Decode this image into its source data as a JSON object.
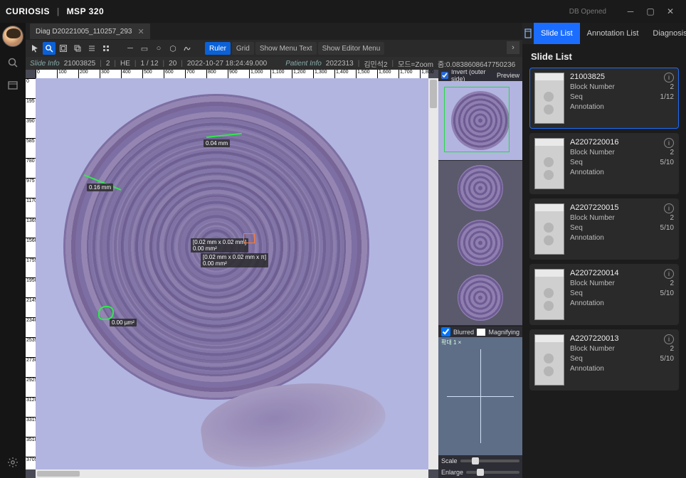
{
  "app": {
    "brand1": "CURIOSIS",
    "brand2": "MSP 320",
    "db_status": "DB Opened"
  },
  "tab": {
    "title": "Diag D20221005_110257_293"
  },
  "toolbar": {
    "ruler": "Ruler",
    "grid": "Grid",
    "menutext": "Show Menu Text",
    "editormenu": "Show Editor Menu"
  },
  "slideinfo": {
    "label": "Slide Info",
    "id": "21003825",
    "block": "2",
    "stain": "HE",
    "seq": "1 / 12",
    "mag": "20",
    "datetime": "2022-10-27 18:24:49.000",
    "patient_label": "Patient Info",
    "patient_id": "2022313",
    "patient_name": "김민석2",
    "mode_label": "모드=Zoom",
    "zoom": "줌:0.0838608647750236"
  },
  "ruler_h": [
    "0",
    "100",
    "200",
    "300",
    "400",
    "500",
    "600",
    "700",
    "800",
    "900",
    "1,000",
    "1,100",
    "1,200",
    "1,300",
    "1,400",
    "1,500",
    "1,600",
    "1,700",
    "1,800"
  ],
  "ruler_v": [
    "0",
    "195",
    "390",
    "585",
    "780",
    "975",
    "1170",
    "1365",
    "1560",
    "1755",
    "1950",
    "2145",
    "2340",
    "2535",
    "2730",
    "2925",
    "3120",
    "3315",
    "3510",
    "3705"
  ],
  "measurements": {
    "m1": "0.04 mm",
    "m2": "0.16 mm",
    "m3a": "[0.02 mm x 0.02 mm]",
    "m3b": "0.00 mm²",
    "m4a": "[0.02 mm x 0.02 mm x π]",
    "m4b": "0.00 mm²",
    "m5": "0.00 µm²"
  },
  "panels": {
    "invert": "Invert (outer side)",
    "preview": "Preview",
    "blurred": "Blurred",
    "magnify": "Magnifying",
    "navlabel": "확대 1 ×",
    "scale": "Scale",
    "enlarge": "Enlarge"
  },
  "right": {
    "tabs": {
      "slidelist": "Slide List",
      "annotation": "Annotation List",
      "diagnosis": "Diagnosis"
    },
    "title": "Slide List",
    "fields": {
      "block": "Block Number",
      "seq": "Seq",
      "anno": "Annotation"
    },
    "cards": [
      {
        "name": "21003825",
        "block": "2",
        "seq": "1/12",
        "active": true
      },
      {
        "name": "A2207220016",
        "block": "2",
        "seq": "5/10",
        "active": false
      },
      {
        "name": "A2207220015",
        "block": "2",
        "seq": "5/10",
        "active": false
      },
      {
        "name": "A2207220014",
        "block": "2",
        "seq": "5/10",
        "active": false
      },
      {
        "name": "A2207220013",
        "block": "2",
        "seq": "5/10",
        "active": false
      }
    ]
  }
}
